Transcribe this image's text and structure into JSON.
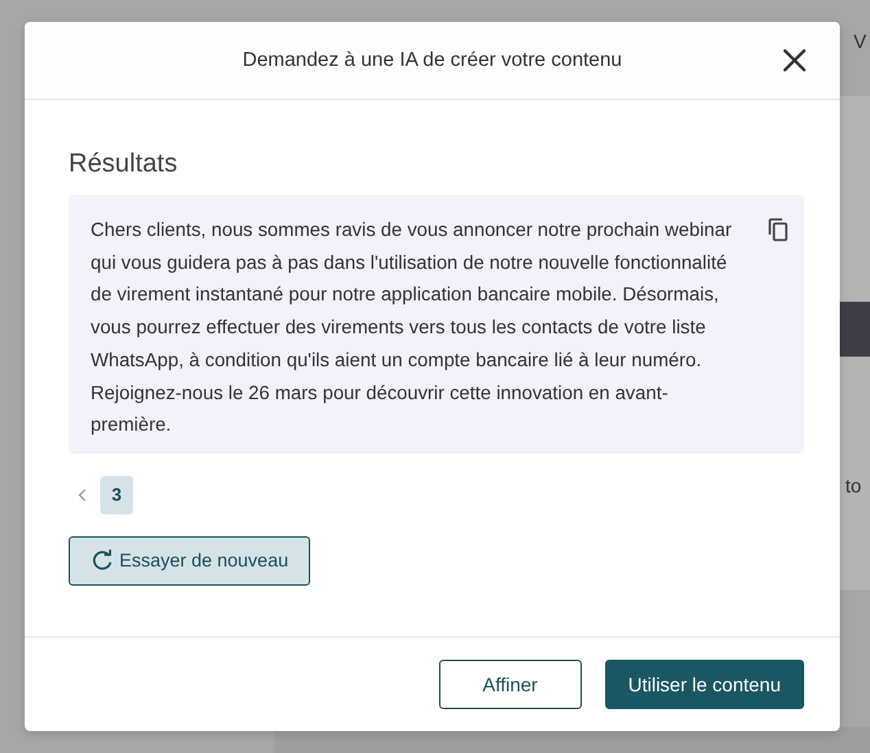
{
  "background": {
    "texts": [
      "V",
      "to"
    ]
  },
  "dialog": {
    "title": "Demandez à une IA de créer votre contenu",
    "section_title": "Résultats",
    "result_text": "Chers clients, nous sommes ravis de vous annoncer notre prochain webinar qui vous guidera pas à pas dans l'utilisation de notre nouvelle fonctionnalité de virement instantané pour notre application bancaire mobile. Désormais, vous pourrez effectuer des virements vers tous les contacts de votre liste WhatsApp, à condition qu'ils aient un compte bancaire lié à leur numéro. Rejoignez-nous le 26 mars pour découvrir cette innovation en avant-première.",
    "pages": [
      {
        "label": "3",
        "selected": true
      }
    ],
    "retry_button": "Essayer de nouveau",
    "buttons": [
      {
        "label": "Affiner",
        "kind": "secondary"
      },
      {
        "label": "Utiliser le contenu",
        "kind": "primary"
      }
    ]
  }
}
